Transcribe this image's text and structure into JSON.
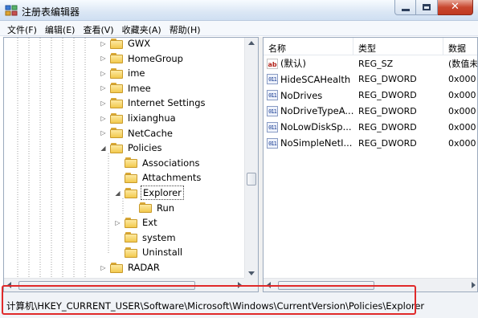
{
  "window": {
    "title": "注册表编辑器",
    "close_glyph": "✕"
  },
  "menu": [
    "文件(F)",
    "编辑(E)",
    "查看(V)",
    "收藏夹(A)",
    "帮助(H)"
  ],
  "tree": {
    "items": [
      {
        "label": "GWX",
        "level": 1,
        "expander": "▷"
      },
      {
        "label": "HomeGroup",
        "level": 1,
        "expander": "▷"
      },
      {
        "label": "ime",
        "level": 1,
        "expander": "▷"
      },
      {
        "label": "Imee",
        "level": 1,
        "expander": "▷"
      },
      {
        "label": "Internet Settings",
        "level": 1,
        "expander": "▷"
      },
      {
        "label": "lixianghua",
        "level": 1,
        "expander": "▷"
      },
      {
        "label": "NetCache",
        "level": 1,
        "expander": "▷"
      },
      {
        "label": "Policies",
        "level": 1,
        "expander": "◢"
      },
      {
        "label": "Associations",
        "level": 2,
        "expander": ""
      },
      {
        "label": "Attachments",
        "level": 2,
        "expander": ""
      },
      {
        "label": "Explorer",
        "level": 2,
        "expander": "◢",
        "selected": true
      },
      {
        "label": "Run",
        "level": 3,
        "expander": ""
      },
      {
        "label": "Ext",
        "level": 2,
        "expander": "▷"
      },
      {
        "label": "system",
        "level": 2,
        "expander": ""
      },
      {
        "label": "Uninstall",
        "level": 2,
        "expander": ""
      },
      {
        "label": "RADAR",
        "level": 1,
        "expander": "▷"
      }
    ]
  },
  "list": {
    "columns": [
      "名称",
      "类型",
      "数据"
    ],
    "rows": [
      {
        "name": "(默认)",
        "type": "REG_SZ",
        "data": "(数值未",
        "icon": "string-value-icon",
        "glyph": "ab"
      },
      {
        "name": "HideSCAHealth",
        "type": "REG_DWORD",
        "data": "0x000",
        "icon": "binary-value-icon",
        "glyph": "011"
      },
      {
        "name": "NoDrives",
        "type": "REG_DWORD",
        "data": "0x000",
        "icon": "binary-value-icon",
        "glyph": "011"
      },
      {
        "name": "NoDriveTypeA...",
        "type": "REG_DWORD",
        "data": "0x000",
        "icon": "binary-value-icon",
        "glyph": "011"
      },
      {
        "name": "NoLowDiskSp...",
        "type": "REG_DWORD",
        "data": "0x000",
        "icon": "binary-value-icon",
        "glyph": "011"
      },
      {
        "name": "NoSimpleNetI...",
        "type": "REG_DWORD",
        "data": "0x000",
        "icon": "binary-value-icon",
        "glyph": "011"
      }
    ]
  },
  "status": {
    "path": "计算机\\HKEY_CURRENT_USER\\Software\\Microsoft\\Windows\\CurrentVersion\\Policies\\Explorer"
  },
  "colors": {
    "highlight_border": "#e02a2a",
    "folder_yellow": "#f2c94e"
  }
}
